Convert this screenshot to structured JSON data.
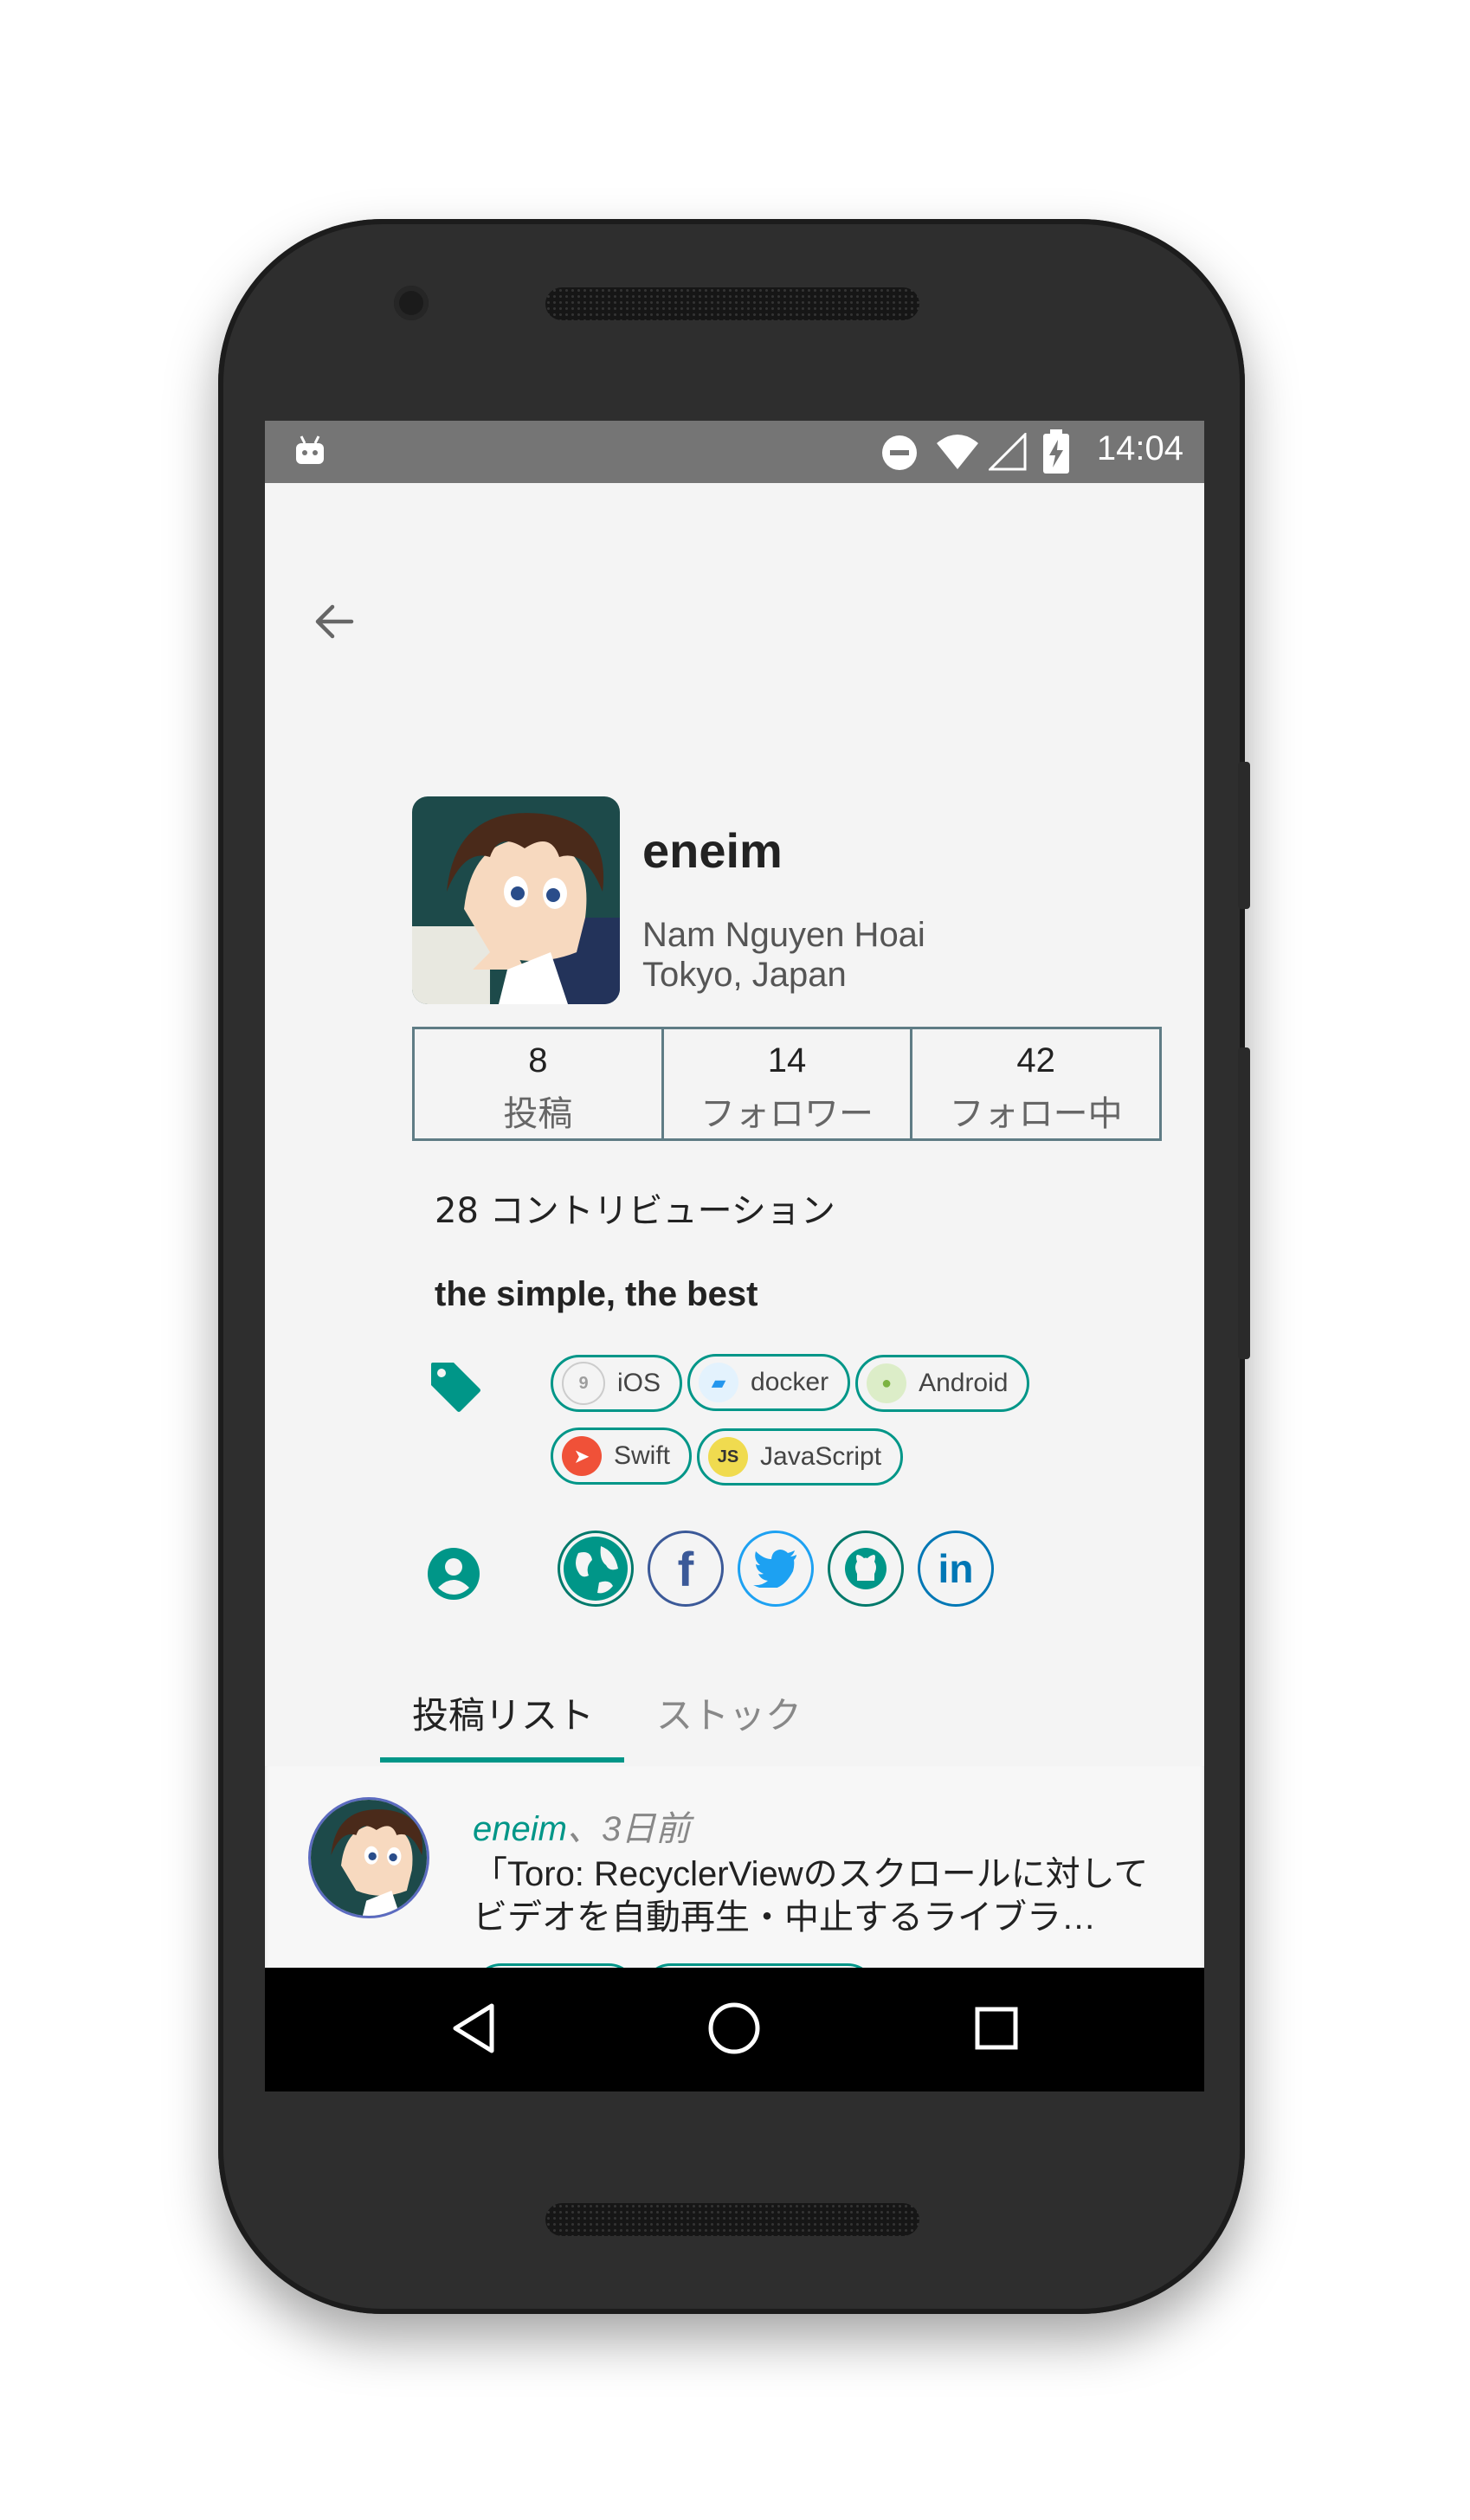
{
  "status_bar": {
    "time": "14:04"
  },
  "profile": {
    "username": "eneim",
    "real_name": "Nam Nguyen Hoai",
    "location": "Tokyo, Japan",
    "stats": [
      {
        "value": "8",
        "label": "投稿"
      },
      {
        "value": "14",
        "label": "フォロワー"
      },
      {
        "value": "42",
        "label": "フォロー中"
      }
    ],
    "contributions": "28 コントリビューション",
    "bio": "the simple, the best",
    "tags": [
      {
        "label": "iOS",
        "icon": "ios-icon",
        "color": "#9e9e9e"
      },
      {
        "label": "docker",
        "icon": "docker-icon",
        "color": "#2496ed"
      },
      {
        "label": "Android",
        "icon": "android-icon",
        "color": "#8bc34a"
      },
      {
        "label": "Swift",
        "icon": "swift-icon",
        "color": "#f05138"
      },
      {
        "label": "JavaScript",
        "icon": "javascript-icon",
        "color": "#f0db4f"
      }
    ],
    "social_icons": [
      "globe-icon",
      "facebook-icon",
      "twitter-icon",
      "github-icon",
      "linkedin-icon"
    ]
  },
  "tabs": [
    {
      "label": "投稿リスト",
      "selected": true
    },
    {
      "label": "ストック",
      "selected": false
    }
  ],
  "post": {
    "author": "eneim",
    "time_ago": "、3日前",
    "title": "「Toro: RecyclerViewのスクロールに対してビデオを自動再生・中止するライブラ…"
  },
  "colors": {
    "accent": "#009688",
    "status_bar": "#757575",
    "border": "#5f7c85"
  }
}
